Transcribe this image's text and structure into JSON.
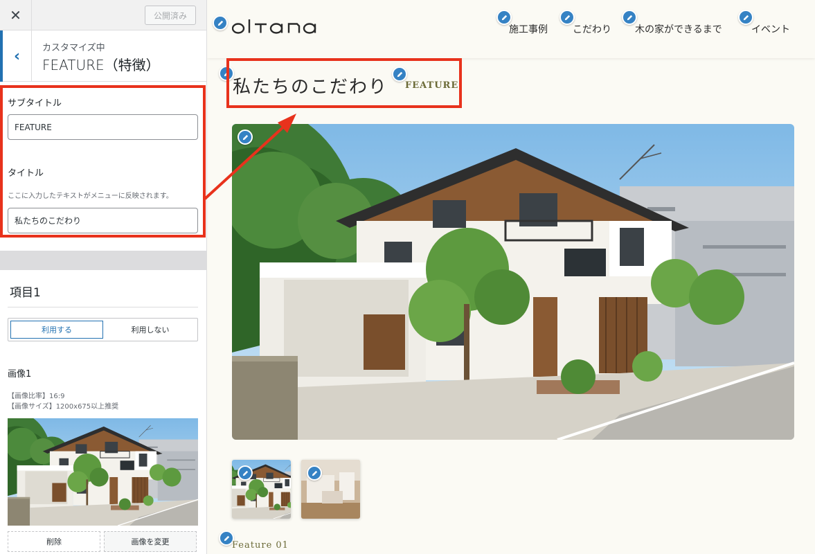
{
  "customizer": {
    "close_icon": "close-icon",
    "publish_label": "公開済み",
    "section": {
      "breadcrumb": "カスタマイズ中",
      "title": "FEATURE（特徴）"
    },
    "fields": {
      "subtitle_label": "サブタイトル",
      "subtitle_value": "FEATURE",
      "title_label": "タイトル",
      "title_desc": "ここに入力したテキストがメニューに反映されます。",
      "title_value": "私たちのこだわり"
    },
    "item": {
      "heading": "項目1",
      "toggle_use": "利用する",
      "toggle_nouse": "利用しない",
      "toggle_selected": "利用する",
      "image_label": "画像1",
      "image_note_ratio": "【画像比率】16:9",
      "image_note_size": "【画像サイズ】1200x675以上推奨",
      "remove_label": "削除",
      "change_label": "画像を変更"
    }
  },
  "site": {
    "logo_text": "oltana",
    "nav": [
      "施工事例",
      "こだわり",
      "木の家ができるまで",
      "イベント"
    ],
    "feature_title": "私たちのこだわり",
    "feature_subtitle": "FEATURE",
    "feature_number": "Feature 01",
    "colors": {
      "accent_olive": "#6b6a37",
      "highlight_red": "#e8321c",
      "edit_blue": "#3582c4",
      "wp_blue": "#2271b1"
    }
  }
}
